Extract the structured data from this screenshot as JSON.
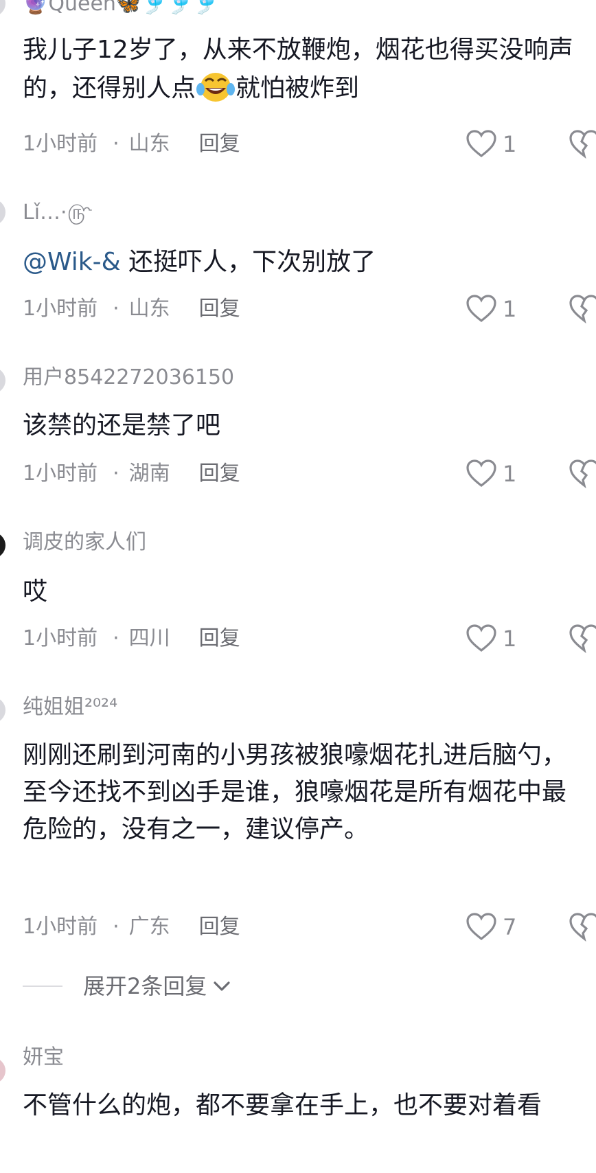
{
  "comments": [
    {
      "username": "🔮Queen🦋🎐🎐🎐",
      "text_before": "我儿子12岁了，从来不放鞭炮，烟花也得买没响声的，还得别人点",
      "text_after": "就怕被炸到",
      "time": "1小时前",
      "location": "山东",
      "reply": "回复",
      "likes": "1"
    },
    {
      "username": "Lǐ…·௹",
      "mention": "@Wik-&",
      "text": " 还挺吓人，下次别放了",
      "time": "1小时前",
      "location": "山东",
      "reply": "回复",
      "likes": "1"
    },
    {
      "username": "用户8542272036150",
      "text": "该禁的还是禁了吧",
      "time": "1小时前",
      "location": "湖南",
      "reply": "回复",
      "likes": "1"
    },
    {
      "username": "调皮的家人们",
      "text": "哎",
      "time": "1小时前",
      "location": "四川",
      "reply": "回复",
      "likes": "1"
    },
    {
      "username": "纯姐姐²⁰²⁴",
      "text": "刚刚还刷到河南的小男孩被狼嚎烟花扎进后脑勺，至今还找不到凶手是谁，狼嚎烟花是所有烟花中最危险的，没有之一，建议停产。",
      "time": "1小时前",
      "location": "广东",
      "reply": "回复",
      "likes": "7"
    },
    {
      "username": "妍宝",
      "text": "不管什么的炮，都不要拿在手上，也不要对着看"
    }
  ],
  "expand_replies": "展开2条回复",
  "icons": {
    "like": "heart-outline-icon",
    "dislike": "broken-heart-icon",
    "expand": "chevron-down-icon",
    "emoji": "tears-of-joy-emoji"
  }
}
